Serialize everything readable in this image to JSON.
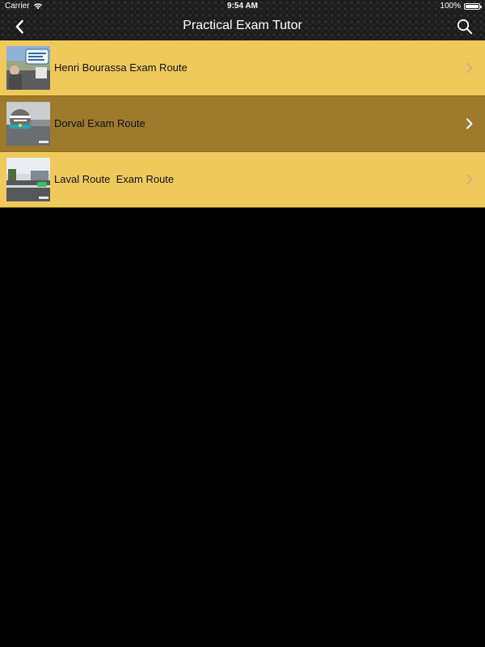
{
  "status_bar": {
    "carrier": "Carrier",
    "time": "9:54 AM",
    "battery": "100%",
    "battery_level": 1.0
  },
  "nav": {
    "title": "Practical Exam Tutor",
    "back_icon": "chevron-left-icon",
    "search_icon": "search-icon"
  },
  "routes": [
    {
      "label": "Henri Bourassa Exam Route",
      "selected": false
    },
    {
      "label": "Dorval Exam Route",
      "selected": true
    },
    {
      "label": "Laval Route  Exam Route",
      "selected": false
    }
  ],
  "colors": {
    "row_background": "#f0c95c",
    "row_selected_background": "#9d7a2c",
    "list_background": "#000000"
  }
}
